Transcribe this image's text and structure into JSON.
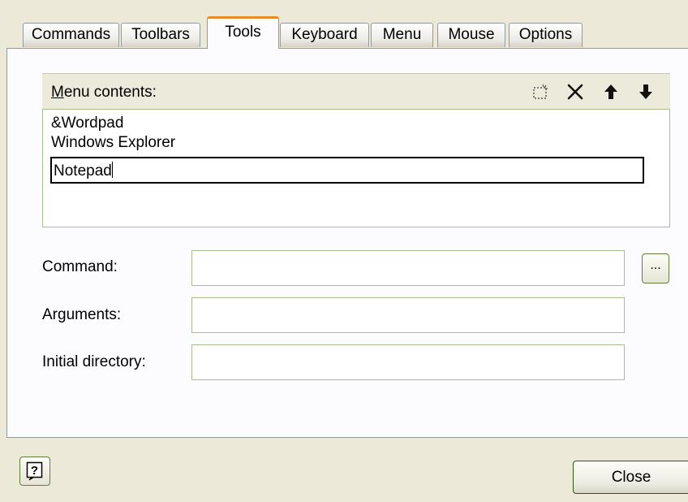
{
  "tabs": [
    {
      "label": "Commands",
      "active": false
    },
    {
      "label": "Toolbars",
      "active": false
    },
    {
      "label": "Tools",
      "active": true
    },
    {
      "label": "Keyboard",
      "active": false
    },
    {
      "label": "Menu",
      "active": false
    },
    {
      "label": "Mouse",
      "active": false
    },
    {
      "label": "Options",
      "active": false
    }
  ],
  "menu_contents": {
    "label_underlined": "M",
    "label_rest": "enu contents:",
    "toolbar_icons": [
      "new-item-icon",
      "delete-icon",
      "move-up-icon",
      "move-down-icon"
    ],
    "items": [
      "&Wordpad",
      "Windows Explorer"
    ],
    "editing_item": "Notepad"
  },
  "fields": {
    "command_label": "Command:",
    "command_value": "",
    "arguments_label": "Arguments:",
    "arguments_value": "",
    "initial_directory_label": "Initial directory:",
    "initial_directory_value": "",
    "browse_label": "..."
  },
  "buttons": {
    "help_label": "?",
    "close_label": "Close"
  },
  "colors": {
    "dialog_background": "#ece9d8",
    "active_tab_accent": "#e68b2c",
    "field_border": "#a7c08e"
  }
}
